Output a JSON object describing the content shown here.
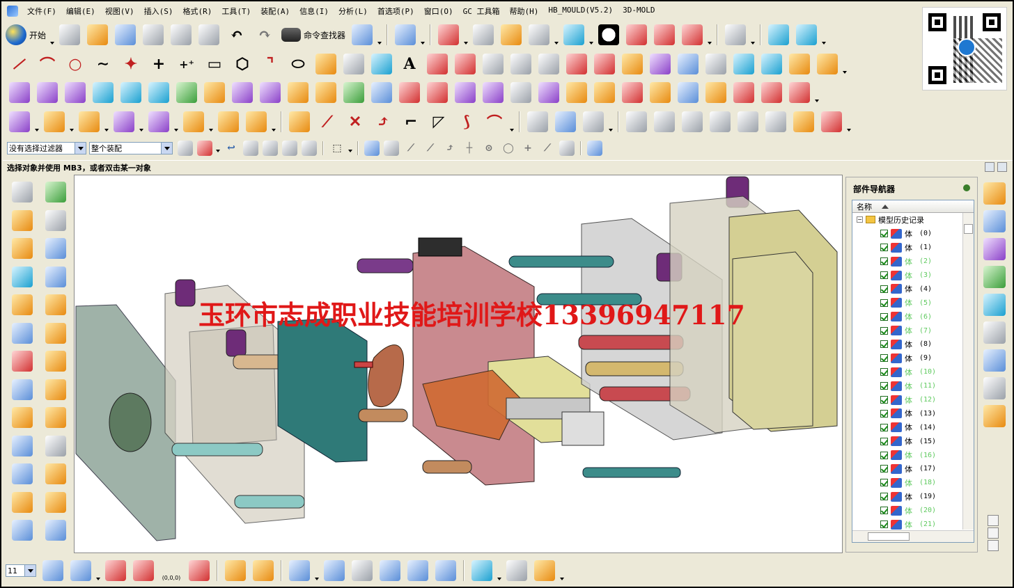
{
  "menu": {
    "items": [
      "文件(F)",
      "编辑(E)",
      "视图(V)",
      "插入(S)",
      "格式(R)",
      "工具(T)",
      "装配(A)",
      "信息(I)",
      "分析(L)",
      "首选项(P)",
      "窗口(O)",
      "GC 工具箱",
      "帮助(H)",
      "HB_MOULD(V5.2)",
      "3D-MOLD"
    ]
  },
  "toolbar": {
    "start_label": "开始",
    "find_command_label": "命令查找器",
    "text_icon_glyph": "A"
  },
  "filters": {
    "selection_filter": "没有选择过滤器",
    "assembly_scope": "整个装配"
  },
  "status": {
    "prompt": "选择对象并使用 MB3，或者双击某一对象"
  },
  "viewport": {
    "watermark": "玉环市志成职业技能培训学校13396947117"
  },
  "navigator": {
    "title": "部件导航器",
    "column_name": "名称",
    "root": "模型历史记录",
    "rows": [
      {
        "label": "体",
        "idx": "(0)",
        "dim": false
      },
      {
        "label": "体",
        "idx": "(1)",
        "dim": false
      },
      {
        "label": "体",
        "idx": "(2)",
        "dim": true
      },
      {
        "label": "体",
        "idx": "(3)",
        "dim": true
      },
      {
        "label": "体",
        "idx": "(4)",
        "dim": false
      },
      {
        "label": "体",
        "idx": "(5)",
        "dim": true
      },
      {
        "label": "体",
        "idx": "(6)",
        "dim": true
      },
      {
        "label": "体",
        "idx": "(7)",
        "dim": true
      },
      {
        "label": "体",
        "idx": "(8)",
        "dim": false
      },
      {
        "label": "体",
        "idx": "(9)",
        "dim": false
      },
      {
        "label": "体",
        "idx": "(10)",
        "dim": true
      },
      {
        "label": "体",
        "idx": "(11)",
        "dim": true
      },
      {
        "label": "体",
        "idx": "(12)",
        "dim": true
      },
      {
        "label": "体",
        "idx": "(13)",
        "dim": false
      },
      {
        "label": "体",
        "idx": "(14)",
        "dim": false
      },
      {
        "label": "体",
        "idx": "(15)",
        "dim": false
      },
      {
        "label": "体",
        "idx": "(16)",
        "dim": true
      },
      {
        "label": "体",
        "idx": "(17)",
        "dim": false
      },
      {
        "label": "体",
        "idx": "(18)",
        "dim": true
      },
      {
        "label": "体",
        "idx": "(19)",
        "dim": false
      },
      {
        "label": "体",
        "idx": "(20)",
        "dim": true
      },
      {
        "label": "体",
        "idx": "(21)",
        "dim": true
      }
    ]
  },
  "bottom": {
    "layer_value": "11",
    "origin_label": "(0,0,0)"
  },
  "colors": {
    "watermark": "#e01818",
    "dim_row": "#5ec95e"
  }
}
